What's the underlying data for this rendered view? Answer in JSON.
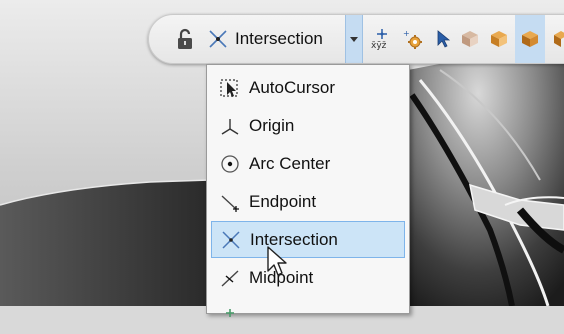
{
  "toolbar": {
    "snap_mode_label": "Intersection",
    "icons": [
      "lock-icon",
      "intersection-snap-icon",
      "chevron-down-icon",
      "xyz-coordinate-icon",
      "snap-settings-gear-icon",
      "select-arrow-icon",
      "cube-icon",
      "cube-icon",
      "cube-icon"
    ]
  },
  "snap_menu": {
    "items": [
      {
        "label": "AutoCursor",
        "icon": "autocursor-icon",
        "selected": false
      },
      {
        "label": "Origin",
        "icon": "origin-axes-icon",
        "selected": false
      },
      {
        "label": "Arc Center",
        "icon": "arc-center-icon",
        "selected": false
      },
      {
        "label": "Endpoint",
        "icon": "endpoint-icon",
        "selected": false
      },
      {
        "label": "Intersection",
        "icon": "intersection-icon",
        "selected": true
      },
      {
        "label": "Midpoint",
        "icon": "midpoint-icon",
        "selected": false
      },
      {
        "label": "",
        "icon": "snap-point-icon",
        "selected": false
      }
    ]
  },
  "colors": {
    "menu_highlight": "#cce4f7",
    "menu_highlight_border": "#7eb4ea",
    "toolbar_bg": "#ececec",
    "accent_orange": "#e8a23a",
    "accent_blue": "#2a5ea8"
  }
}
